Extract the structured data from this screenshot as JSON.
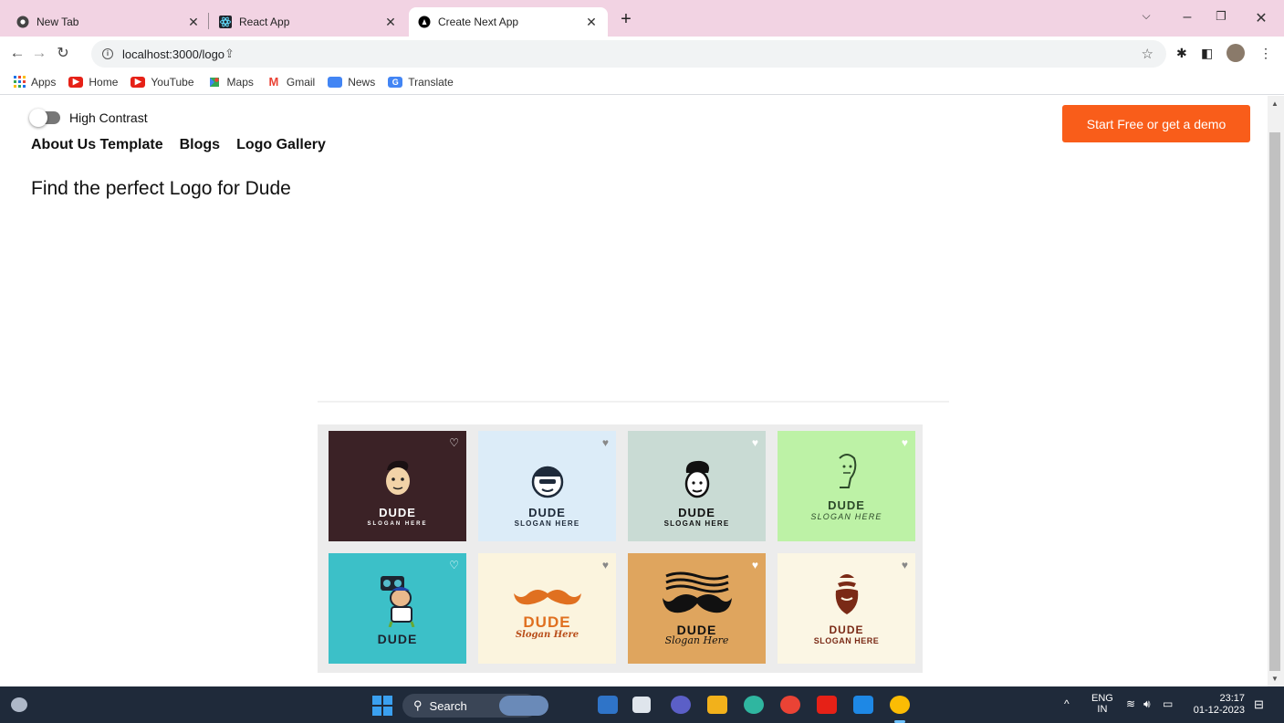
{
  "browser": {
    "tabs": [
      {
        "title": "New Tab",
        "active": false
      },
      {
        "title": "React App",
        "active": false
      },
      {
        "title": "Create Next App",
        "active": true
      }
    ],
    "url": "localhost:3000/logo",
    "bookmarks": [
      "Apps",
      "Home",
      "YouTube",
      "Maps",
      "Gmail",
      "News",
      "Translate"
    ]
  },
  "page": {
    "contrast_label": "High Contrast",
    "nav": [
      "About Us Template",
      "Blogs",
      "Logo Gallery"
    ],
    "headline": "Find the perfect Logo for Dude",
    "cta_label": "Start Free or get a demo",
    "cta_color": "#f95d1a",
    "logos": [
      {
        "brand": "DUDE",
        "slogan": "SLOGAN HERE",
        "bg": "#3b2226",
        "fg": "#ffffff",
        "icon": "dude-face-icon"
      },
      {
        "brand": "DUDE",
        "slogan": "SLOGAN HERE",
        "bg": "#dcecf8",
        "fg": "#1e2a3a",
        "icon": "cap-dude-icon"
      },
      {
        "brand": "DUDE",
        "slogan": "SLOGAN HERE",
        "bg": "#c9dbd4",
        "fg": "#111111",
        "icon": "pompadour-dude-icon"
      },
      {
        "brand": "DUDE",
        "slogan": "SLOGAN HERE",
        "bg": "#bdf2a6",
        "fg": "#2d4a2a",
        "icon": "line-dude-icon"
      },
      {
        "brand": "DUDE",
        "slogan": "",
        "bg": "#3cc0c8",
        "fg": "#1d2430",
        "icon": "boombox-dude-icon"
      },
      {
        "brand": "DUDE",
        "slogan": "Slogan Here",
        "bg": "#fbf4de",
        "fg": "#e07020",
        "icon": "mustache-icon"
      },
      {
        "brand": "DUDE",
        "slogan": "Slogan Here",
        "bg": "#dfa55e",
        "fg": "#111111",
        "icon": "wavy-mustache-icon"
      },
      {
        "brand": "DUDE",
        "slogan": "SLOGAN HERE",
        "bg": "#fbf6e4",
        "fg": "#7a2a16",
        "icon": "beard-icon"
      }
    ]
  },
  "taskbar": {
    "search_label": "Search",
    "lang": "ENG",
    "region": "IN",
    "time": "23:17",
    "date": "01-12-2023"
  }
}
